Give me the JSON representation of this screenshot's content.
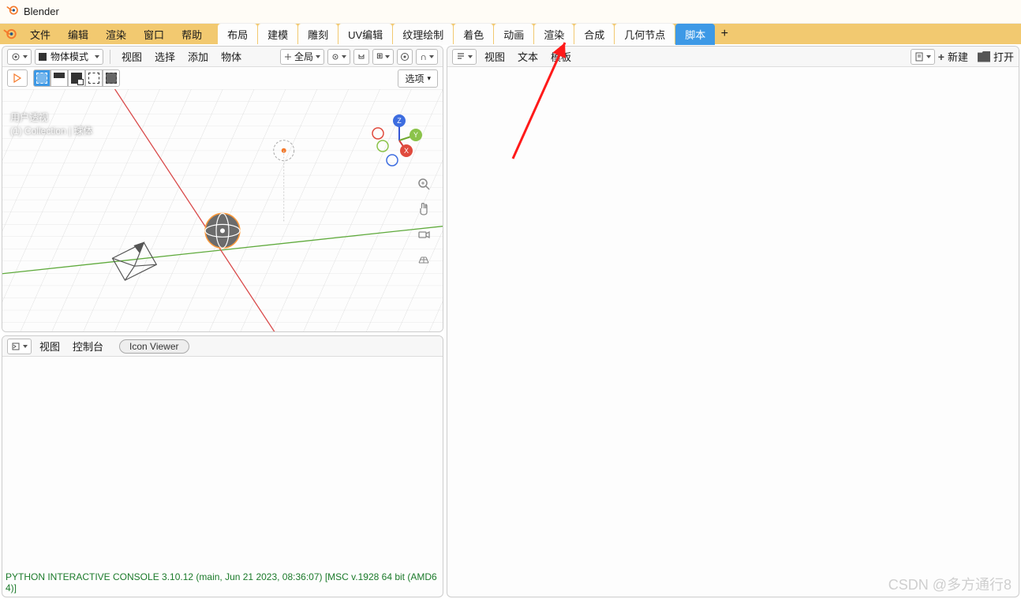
{
  "window": {
    "title": "Blender"
  },
  "main_menu": [
    "文件",
    "编辑",
    "渲染",
    "窗口",
    "帮助"
  ],
  "workspaces": {
    "tabs": [
      "布局",
      "建模",
      "雕刻",
      "UV编辑",
      "纹理绘制",
      "着色",
      "动画",
      "渲染",
      "合成",
      "几何节点",
      "脚本"
    ],
    "active_index": 10
  },
  "viewport": {
    "mode_label": "物体模式",
    "menus": [
      "视图",
      "选择",
      "添加",
      "物体"
    ],
    "orientation_label": "全局",
    "options_btn": "选项",
    "overlay_line1": "用户透视",
    "overlay_line2": "(1) Collection | 球体",
    "gizmo": {
      "x": "X",
      "y": "Y",
      "z": "Z"
    }
  },
  "console": {
    "menus": [
      "视图",
      "控制台"
    ],
    "icon_viewer": "Icon Viewer",
    "output": "PYTHON INTERACTIVE CONSOLE 3.10.12 (main, Jun 21 2023, 08:36:07) [MSC v.1928 64 bit (AMD64)]"
  },
  "text_editor": {
    "menus": [
      "视图",
      "文本",
      "模板"
    ],
    "new_btn": "新建",
    "open_btn": "打开"
  },
  "watermark": "CSDN @多方通行8"
}
